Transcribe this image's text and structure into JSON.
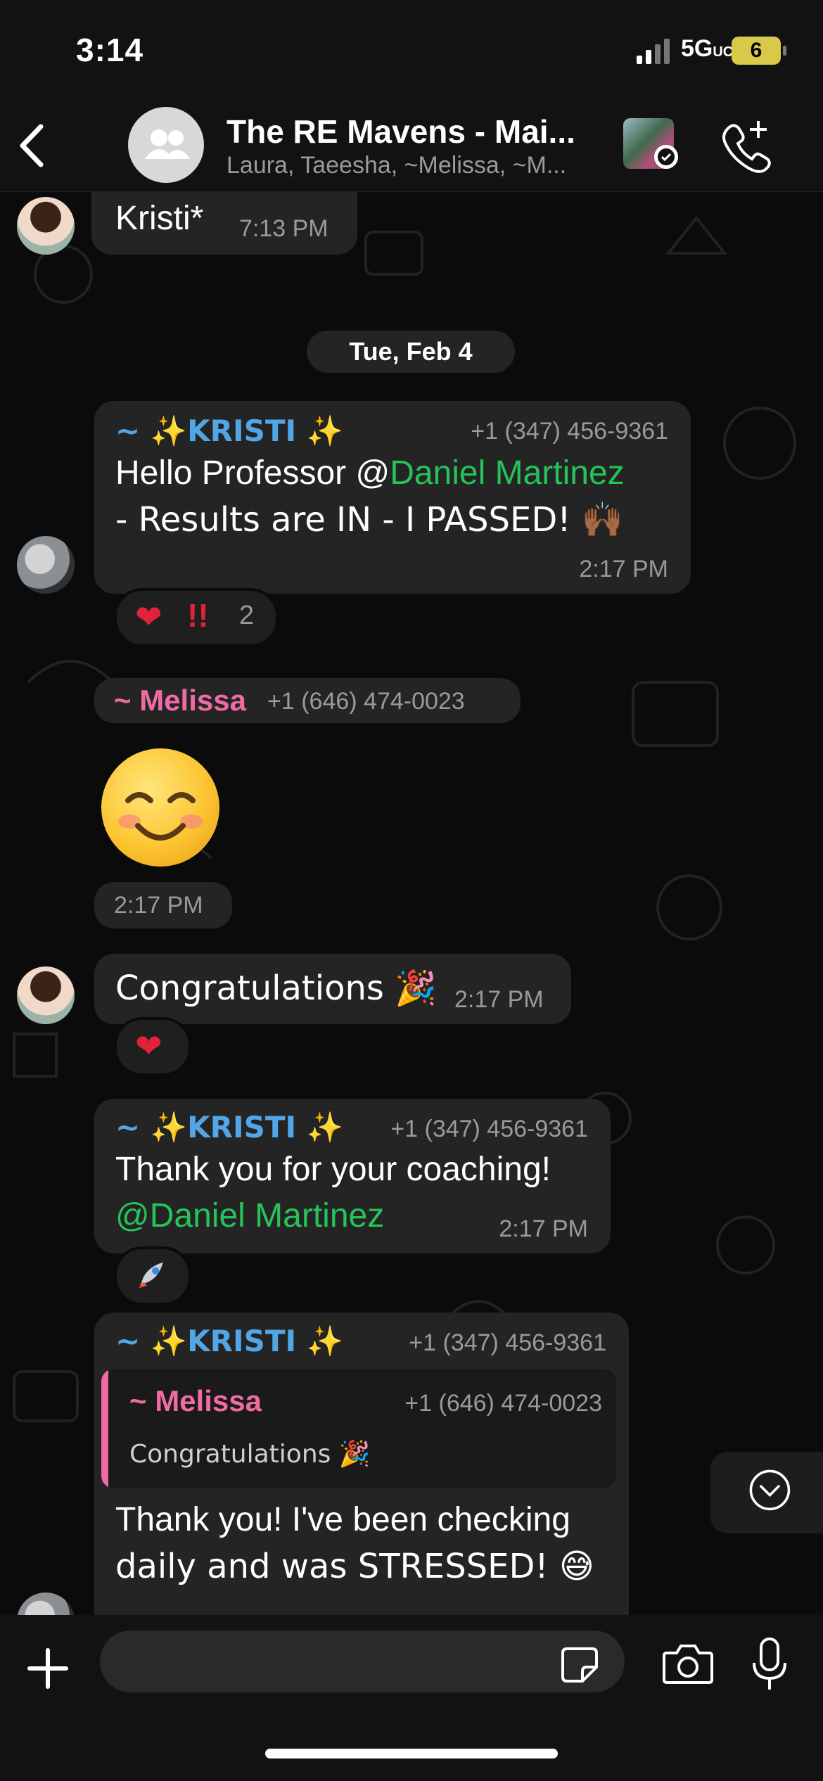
{
  "status_bar": {
    "time": "3:14",
    "network": "5G",
    "network_suffix": "UC",
    "battery": "6"
  },
  "header": {
    "title": "The RE Mavens - Mai...",
    "subtitle": "Laura, Taeesha, ~Melissa, ~M..."
  },
  "messages": {
    "m0": {
      "text": "Kristi*",
      "time": "7:13 PM"
    },
    "date_separator": "Tue, Feb 4",
    "m1": {
      "sender": "~ ✨KRISTI ✨",
      "phone": "+1 (347) 456-9361",
      "text_a": "Hello Professor @",
      "mention": "Daniel Martinez",
      "text_b": "- Results are IN - I PASSED! 🙌🏾",
      "time": "2:17 PM",
      "reaction_count": "2"
    },
    "m2": {
      "sender": "~ Melissa",
      "phone": "+1 (646) 474-0023",
      "emoji": "😊",
      "time": "2:17 PM"
    },
    "m3": {
      "text": "Congratulations 🎉",
      "time": "2:17 PM"
    },
    "m4": {
      "sender": "~ ✨KRISTI ✨",
      "phone": "+1 (347) 456-9361",
      "text": "Thank you for your coaching!",
      "mention_prefix": "@",
      "mention": "Daniel Martinez",
      "time": "2:17 PM"
    },
    "m5": {
      "sender": "~ ✨KRISTI ✨",
      "phone": "+1 (347) 456-9361",
      "quote_sender": "~ Melissa",
      "quote_phone": "+1 (646) 474-0023",
      "quote_text": "Congratulations 🎉",
      "text_line1": "Thank you! I've been checking",
      "text_line2": "daily and was STRESSED! 😅"
    }
  },
  "colors": {
    "background": "#0b0b0b",
    "bubble": "#242424",
    "kristi_name": "#53a6e6",
    "melissa_name": "#f06ba4",
    "mention": "#25c35a"
  },
  "icons": [
    "back-chevron-icon",
    "group-icon",
    "add-call-icon",
    "plus-icon",
    "sticker-icon",
    "camera-icon",
    "mic-icon",
    "chevron-down-icon"
  ]
}
